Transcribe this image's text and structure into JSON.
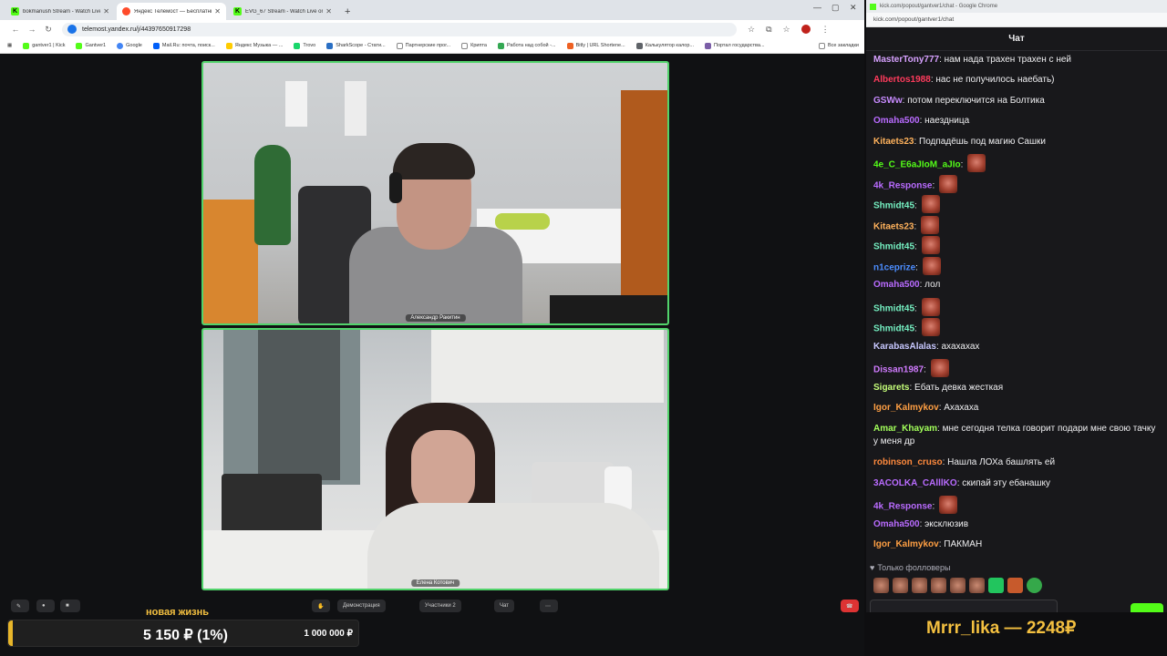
{
  "browser": {
    "tabs": [
      {
        "title": "bokmanush Stream - Watch Live",
        "active": false,
        "color": "#53fc18",
        "glyph": "K"
      },
      {
        "title": "Яндекс Телемост — Бесплатные",
        "active": true,
        "color": "#ff4b2b",
        "glyph": ""
      },
      {
        "title": "EVG_67 Stream - Watch Live on",
        "active": false,
        "color": "#53fc18",
        "glyph": "K"
      }
    ],
    "new_tab": "+",
    "address": "telemost.yandex.ru/j/44397650917298",
    "bookmarks": [
      {
        "label": "gantver1 | Kick",
        "color": "#53fc18"
      },
      {
        "label": "Gantver1",
        "color": "#53fc18"
      },
      {
        "label": "Google",
        "color": "#4285f4"
      },
      {
        "label": "Mail.Ru: почта, поиск...",
        "color": "#005ff9"
      },
      {
        "label": "Яндекс Музыка — ...",
        "color": "#ffcc00"
      },
      {
        "label": "Trovo",
        "color": "#19d66b"
      },
      {
        "label": "SharkScope - Стати...",
        "color": "#2a6fc4"
      },
      {
        "label": "Партнерские прог...",
        "color": "#888888"
      },
      {
        "label": "Крипта",
        "color": "#888888"
      },
      {
        "label": "Работа над собой -...",
        "color": "#34a853"
      },
      {
        "label": "Bitly | URL Shortene...",
        "color": "#ee6123"
      },
      {
        "label": "Калькулятор калор...",
        "color": "#5f6368"
      },
      {
        "label": "Портал государства...",
        "color": "#7b5ea7"
      }
    ],
    "all_bookmarks": "Все закладки"
  },
  "meeting": {
    "participants": [
      {
        "name": "Александр Ракитин"
      },
      {
        "name": "Елена Котович"
      }
    ],
    "toolbar": {
      "share_label": "Демонстрация",
      "participants_label": "Участники",
      "participants_count": "2",
      "chat_label": "Чат"
    }
  },
  "goal": {
    "title": "новая жизнь",
    "current": "5 150 ₽ (1%)",
    "target": "1 000 000 ₽",
    "progress_fraction": 0.01
  },
  "donor_banner": "Mrrr_lika — 2248₽",
  "chat": {
    "window_title": "kick.com/popout/gantver1/chat - Google Chrome",
    "url": "kick.com/popout/gantver1/chat",
    "header": "Чат",
    "messages": [
      {
        "user": "MasterTony777",
        "color": "#d7a1ff",
        "text": "нам нада трахен трахен с ней",
        "emotes": 0
      },
      {
        "user": "Albertos1988",
        "color": "#ff3b5c",
        "text": "нас не получилось наебать)",
        "emotes": 0
      },
      {
        "user": "GSWw",
        "color": "#c88bff",
        "text": "потом переключится на Болтика",
        "emotes": 0
      },
      {
        "user": "Omaha500",
        "color": "#b96bff",
        "text": "наездница",
        "emotes": 0
      },
      {
        "user": "Kitaets23",
        "color": "#ffb25c",
        "text": "Подпадёшь под магию Сашки",
        "emotes": 0
      },
      {
        "user": "4e_C_E6aJIoM_aJIo",
        "color": "#53fc18",
        "text": "",
        "emotes": 1
      },
      {
        "user": "4k_Response",
        "color": "#b96bff",
        "text": "",
        "emotes": 1
      },
      {
        "user": "Shmidt45",
        "color": "#75f0c2",
        "text": "",
        "emotes": 1
      },
      {
        "user": "Kitaets23",
        "color": "#ffb25c",
        "text": "",
        "emotes": 1
      },
      {
        "user": "Shmidt45",
        "color": "#75f0c2",
        "text": "",
        "emotes": 1
      },
      {
        "user": "n1ceprize",
        "color": "#4c8dff",
        "text": "",
        "emotes": 1
      },
      {
        "user": "Omaha500",
        "color": "#b96bff",
        "text": "лол",
        "emotes": 0
      },
      {
        "user": "Shmidt45",
        "color": "#75f0c2",
        "text": "",
        "emotes": 1
      },
      {
        "user": "Shmidt45",
        "color": "#75f0c2",
        "text": "",
        "emotes": 1
      },
      {
        "user": "KarabasAlalas",
        "color": "#c8c8ff",
        "text": "ахахахах",
        "emotes": 0
      },
      {
        "user": "Dissan1987",
        "color": "#d07bff",
        "text": "",
        "emotes": 1
      },
      {
        "user": "Sigarets",
        "color": "#c6ff7a",
        "text": "Ебать девка жесткая",
        "emotes": 0
      },
      {
        "user": "Igor_Kalmykov",
        "color": "#ff9f43",
        "text": "Ахахаха",
        "emotes": 0
      },
      {
        "user": "Amar_Khayam",
        "color": "#a2ff5a",
        "text": "мне сегодня телка говорит подари мне свою тачку у меня др",
        "emotes": 0
      },
      {
        "user": "robinson_cruso",
        "color": "#ff8a3d",
        "text": "Нашла ЛОХа башлять ей",
        "emotes": 0
      },
      {
        "user": "3ACOLKA_CAlllKO",
        "color": "#b96bff",
        "text": "скипай эту ебанашку",
        "emotes": 0
      },
      {
        "user": "4k_Response",
        "color": "#b96bff",
        "text": "",
        "emotes": 1
      },
      {
        "user": "Omaha500",
        "color": "#b96bff",
        "text": "эксклюзив",
        "emotes": 0
      },
      {
        "user": "Igor_Kalmykov",
        "color": "#ff9f43",
        "text": "ПАКМАН",
        "emotes": 0
      }
    ],
    "followers_only": "Только фолловеры"
  }
}
